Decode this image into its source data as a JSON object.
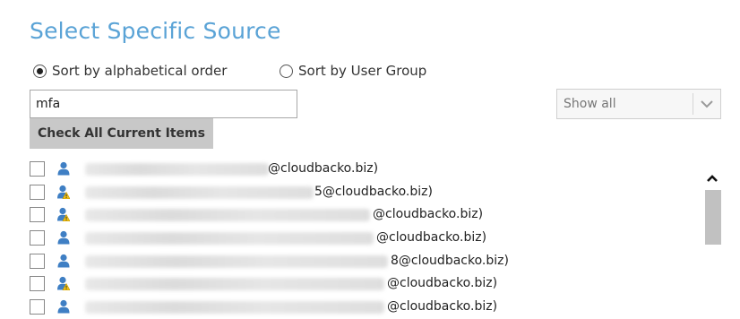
{
  "title": "Select Specific Source",
  "sort_options": [
    {
      "label": "Sort by alphabetical order",
      "checked": true
    },
    {
      "label": "Sort by User Group",
      "checked": false
    }
  ],
  "search": {
    "value": "mfa"
  },
  "check_all_label": "Check All Current Items",
  "filter": {
    "selected": "Show all"
  },
  "items": [
    {
      "suffix": "@cloudbacko.biz)",
      "icon": "user-icon"
    },
    {
      "suffix": "5@cloudbacko.biz)",
      "icon": "user-warning-icon"
    },
    {
      "suffix": "@cloudbacko.biz)",
      "icon": "user-warning-icon"
    },
    {
      "suffix": "@cloudbacko.biz)",
      "icon": "user-icon"
    },
    {
      "suffix": "8@cloudbacko.biz)",
      "icon": "user-icon"
    },
    {
      "suffix": "@cloudbacko.biz)",
      "icon": "user-warning-icon"
    },
    {
      "suffix": "@cloudbacko.biz)",
      "icon": "user-icon"
    }
  ],
  "colors": {
    "title": "#5aa3d6",
    "user_icon": "#3f7fc4",
    "warning": "#f2c316"
  }
}
